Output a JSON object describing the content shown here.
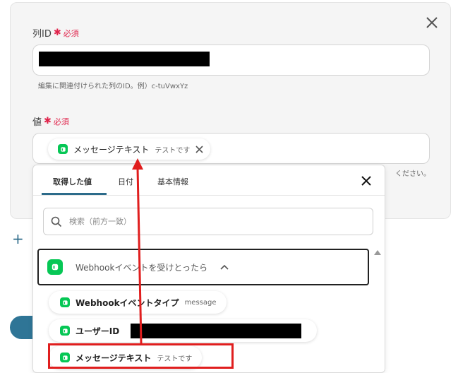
{
  "fields": {
    "column_id": {
      "label": "列ID",
      "required_mark": "✱",
      "required_text": "必須",
      "helper": "編集に関連付けられた列のID。例）c-tuVwxYz"
    },
    "value": {
      "label": "値",
      "required_mark": "✱",
      "required_text": "必須",
      "chip": {
        "title": "メッセージテキスト",
        "sample": "テストです"
      },
      "helper_fragment": "ください。"
    }
  },
  "dropdown": {
    "tabs": [
      {
        "label": "取得した値",
        "active": true
      },
      {
        "label": "日付",
        "active": false
      },
      {
        "label": "基本情報",
        "active": false
      }
    ],
    "search": {
      "placeholder": "検索（前方一致）"
    },
    "group": {
      "label": "Webhookイベントを受けとったら",
      "expanded": true
    },
    "items": [
      {
        "title": "Webhookイベントタイプ",
        "sample": "message"
      },
      {
        "title": "ユーザーID",
        "sample": ""
      },
      {
        "title": "メッセージテキスト",
        "sample": "テストです"
      }
    ]
  },
  "colors": {
    "required": "#e0244b",
    "line_green": "#06c755",
    "accent": "#2c6b8a",
    "highlight": "#e01e1e"
  },
  "icons": [
    "close-icon",
    "line-app-icon",
    "search-icon",
    "chevron-up-icon",
    "plus-icon"
  ]
}
